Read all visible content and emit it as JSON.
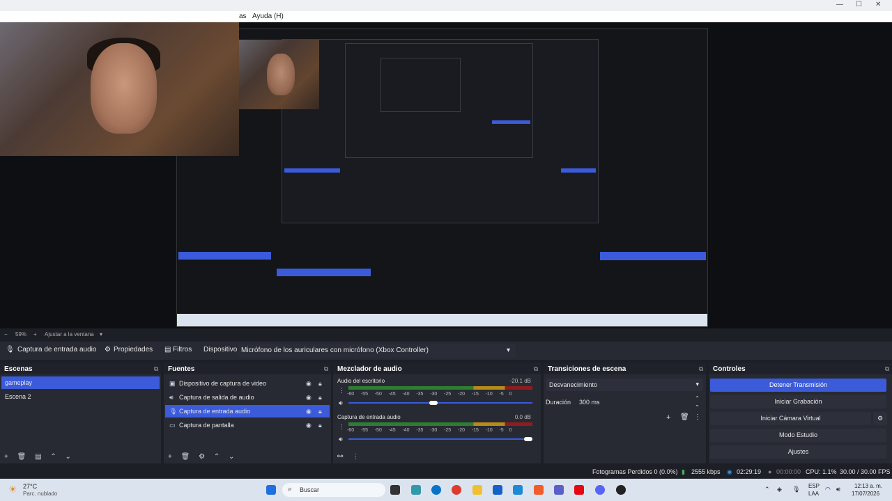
{
  "window": {
    "menu_help": "Ayuda (H)",
    "menu_partial": "as"
  },
  "zoom": {
    "minus": "−",
    "value": "59%",
    "plus": "+",
    "fit": "Ajustar a la ventana"
  },
  "source_toolbar": {
    "source_name": "Captura de entrada audio",
    "properties": "Propiedades",
    "filters": "Filtros",
    "device_label": "Dispositivo",
    "device_value": "Micrófono de los auriculares con micrófono (Xbox Controller)"
  },
  "scenes": {
    "title": "Escenas",
    "items": [
      "gameplay",
      "Escena 2"
    ],
    "selected": 0
  },
  "sources": {
    "title": "Fuentes",
    "items": [
      {
        "label": "Dispositivo de captura de video",
        "icon": "camera-icon"
      },
      {
        "label": "Captura de salida de audio",
        "icon": "speaker-icon"
      },
      {
        "label": "Captura de entrada audio",
        "icon": "microphone-icon"
      },
      {
        "label": "Captura de pantalla",
        "icon": "monitor-icon"
      }
    ],
    "selected": 2
  },
  "mixer": {
    "title": "Mezclador de audio",
    "tracks": [
      {
        "name": "Audio del escritorio",
        "db": "-20.1 dB",
        "volume": 0.46
      },
      {
        "name": "Captura de entrada audio",
        "db": "0.0 dB",
        "volume": 1.0
      }
    ],
    "ticks": [
      "-60",
      "-55",
      "-50",
      "-45",
      "-40",
      "-35",
      "-30",
      "-25",
      "-20",
      "-15",
      "-10",
      "-5",
      "0"
    ]
  },
  "transitions": {
    "title": "Transiciones de escena",
    "type": "Desvanecimiento",
    "duration_label": "Duración",
    "duration_value": "300 ms"
  },
  "controls": {
    "title": "Controles",
    "buttons": [
      "Detener Transmisión",
      "Iniciar Grabación",
      "Iniciar Cámara Virtual",
      "Modo Estudio",
      "Ajustes"
    ]
  },
  "status": {
    "dropped": "Fotogramas Perdidos 0 (0.0%)",
    "bitrate": "2555 kbps",
    "stream_time": "02:29:19",
    "rec_time": "00:00:00",
    "cpu": "CPU: 1.1%",
    "fps": "30.00 / 30.00 FPS"
  },
  "taskbar": {
    "weather_temp": "27°C",
    "weather_desc": "Parc. nublado",
    "search": "Buscar",
    "lang1": "ESP",
    "lang2": "LAA",
    "time": "12:13 a. m.",
    "date": "17/07/2026"
  },
  "colors": {
    "accent": "#3b5bdb",
    "panel": "#272a33",
    "header": "#1f222b",
    "background": "#1d1f26"
  }
}
